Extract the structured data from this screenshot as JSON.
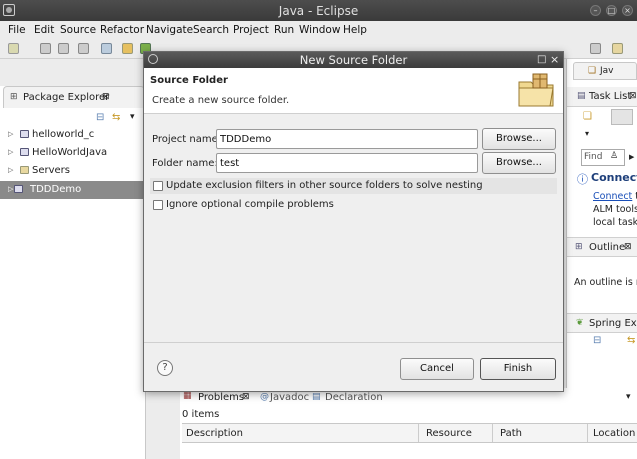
{
  "window": {
    "title": "Java - Eclipse"
  },
  "menu": [
    "File",
    "Edit",
    "Source",
    "Refactor",
    "Navigate",
    "Search",
    "Project",
    "Run",
    "Window",
    "Help"
  ],
  "package_explorer": {
    "title": "Package Explorer",
    "items": [
      {
        "label": "helloworld_c"
      },
      {
        "label": "HelloWorldJava"
      },
      {
        "label": "Servers"
      },
      {
        "label": "TDDDemo"
      }
    ]
  },
  "right_panels": {
    "java_tab": "Jav",
    "task_list": {
      "title": "Task List",
      "find_placeholder": "Find",
      "connect_title": "Connect",
      "connect_link": "Connect",
      "connect_rest": " to",
      "line2": "ALM tools",
      "line3": "local task."
    },
    "outline": {
      "title": "Outline",
      "message": "An outline is n"
    },
    "spring": {
      "title": "Spring Expl"
    }
  },
  "bottom_panel": {
    "tabs": [
      "Problems",
      "Javadoc",
      "Declaration"
    ],
    "count": "0 items",
    "columns": [
      "Description",
      "Resource",
      "Path",
      "Location"
    ]
  },
  "dialog": {
    "title": "New Source Folder",
    "header_title": "Source Folder",
    "header_subtitle": "Create a new source folder.",
    "project_label": "Project name:",
    "project_value": "TDDDemo",
    "folder_label": "Folder name:",
    "folder_value": "test",
    "browse1": "Browse...",
    "browse2": "Browse...",
    "opt1": "Update exclusion filters in other source folders to solve nesting",
    "opt2": "Ignore optional compile problems",
    "cancel": "Cancel",
    "finish": "Finish",
    "help": "?"
  },
  "colors": {
    "selection": "#8a8a8a",
    "link": "#1a4fb8",
    "titlebar": "#3c3c3c"
  }
}
